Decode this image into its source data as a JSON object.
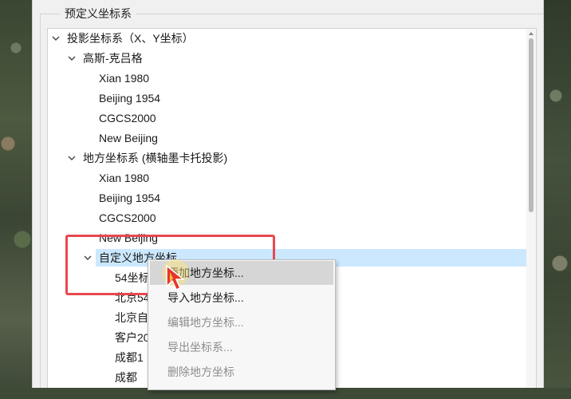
{
  "group": {
    "title": "预定义坐标系"
  },
  "tree": [
    {
      "label": "投影坐标系（X、Y坐标）",
      "level": 0,
      "expanded": true
    },
    {
      "label": "高斯-克吕格",
      "level": 1,
      "expanded": true
    },
    {
      "label": "Xian 1980",
      "level": 2
    },
    {
      "label": "Beijing 1954",
      "level": 2
    },
    {
      "label": "CGCS2000",
      "level": 2
    },
    {
      "label": "New Beijing",
      "level": 2
    },
    {
      "label": "地方坐标系 (横轴墨卡托投影)",
      "level": 1,
      "expanded": true
    },
    {
      "label": "Xian 1980",
      "level": 2
    },
    {
      "label": "Beijing 1954",
      "level": 2
    },
    {
      "label": "CGCS2000",
      "level": 2
    },
    {
      "label": "New Beijing",
      "level": 2
    },
    {
      "label": "自定义地方坐标",
      "level": 2,
      "expanded": true,
      "selected": true
    },
    {
      "label": "54坐标",
      "level": 3
    },
    {
      "label": "北京54",
      "level": 3
    },
    {
      "label": "北京自",
      "level": 3
    },
    {
      "label": "客户20",
      "level": 3
    },
    {
      "label": "成都1",
      "level": 3
    },
    {
      "label": "成都",
      "level": 3
    }
  ],
  "context_menu": {
    "items": [
      {
        "label": "添加地方坐标...",
        "state": "hover"
      },
      {
        "label": "导入地方坐标...",
        "state": "enabled"
      },
      {
        "label": "编辑地方坐标...",
        "state": "disabled"
      },
      {
        "label": "导出坐标系...",
        "state": "disabled"
      },
      {
        "label": "删除地方坐标",
        "state": "disabled"
      }
    ]
  },
  "colors": {
    "selection": "#cce8ff",
    "annotation": "#e8484f",
    "menu_hover": "#d6d6d6",
    "disabled_text": "#8d8d8d"
  },
  "icons": {
    "expand": "chevron-down-icon",
    "cursor": "mouse-pointer-icon"
  }
}
